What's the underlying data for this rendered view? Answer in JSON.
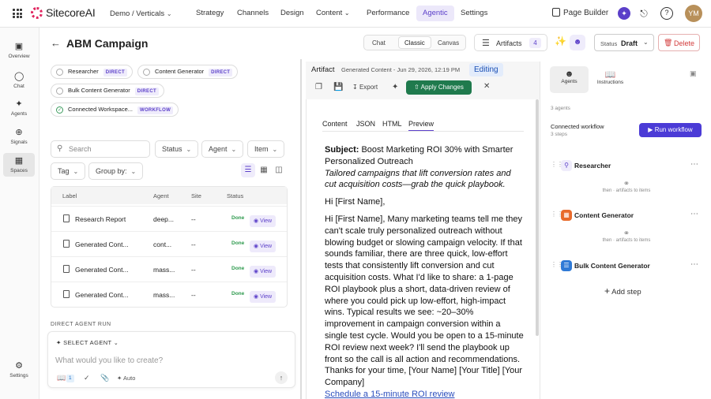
{
  "header": {
    "logo_text": "SitecoreAI",
    "org": "Demo / Verticals",
    "nav": [
      "Strategy",
      "Channels",
      "Design",
      "Content",
      "Performance",
      "Agentic",
      "Settings"
    ],
    "active_nav": "Agentic",
    "page_builder": "Page Builder",
    "avatar_initials": "YM"
  },
  "rail": {
    "items": [
      "Overview",
      "Chat",
      "Agents",
      "Signals",
      "Spaces"
    ],
    "bottom": "Settings"
  },
  "campaign": {
    "title": "ABM Campaign",
    "view_modes": [
      "Chat",
      "Classic",
      "Canvas"
    ],
    "active_mode": "Classic",
    "artifacts_label": "Artifacts",
    "artifacts_count": "4",
    "status_label": "Status",
    "status_value": "Draft",
    "delete_label": "Delete"
  },
  "chips": [
    {
      "label": "Researcher",
      "tag": "DIRECT"
    },
    {
      "label": "Content Generator",
      "tag": "DIRECT"
    },
    {
      "label": "Bulk Content Generator",
      "tag": "DIRECT"
    },
    {
      "label": "Connected Workspace...",
      "tag": "WORKFLOW"
    }
  ],
  "filters": {
    "search_placeholder": "Search",
    "status": "Status",
    "agent": "Agent",
    "item": "Item",
    "tag": "Tag",
    "group_by": "Group by:"
  },
  "table": {
    "columns": [
      "Label",
      "Agent",
      "Site",
      "Status"
    ],
    "rows": [
      {
        "label": "Research Report",
        "agent": "deep...",
        "site": "--",
        "status": "Done",
        "action": "View"
      },
      {
        "label": "Generated Cont...",
        "agent": "cont...",
        "site": "--",
        "status": "Done",
        "action": "View"
      },
      {
        "label": "Generated Cont...",
        "agent": "mass...",
        "site": "--",
        "status": "Done",
        "action": "View"
      },
      {
        "label": "Generated Cont...",
        "agent": "mass...",
        "site": "--",
        "status": "Done",
        "action": "View"
      }
    ]
  },
  "composer": {
    "section_label": "DIRECT AGENT RUN",
    "select_agent": "SELECT AGENT",
    "placeholder": "What would you like to create?",
    "badge": "1",
    "auto": "Auto"
  },
  "artifact": {
    "label": "Artifact",
    "meta": "Generated Content - Jun 29, 2026, 12:19 PM",
    "editing": "Editing",
    "export": "Export",
    "apply": "Apply Changes",
    "tabs": [
      "Content",
      "JSON",
      "HTML",
      "Preview"
    ],
    "active_tab": "Preview",
    "subject_label": "Subject:",
    "subject": "Boost Marketing ROI 30% with Smarter Personalized Outreach",
    "subtitle": "Tailored campaigns that lift conversion rates and cut acquisition costs—grab the quick playbook.",
    "greeting": "Hi [First Name],",
    "body": "Hi [First Name], Many marketing teams tell me they can't scale truly personalized outreach without blowing budget or slowing campaign velocity. If that sounds familiar, there are three quick, low-effort tests that consistently lift conversion and cut acquisition costs. What I'd like to share: a 1-page ROI playbook plus a short, data-driven review of where you could pick up low-effort, high-impact wins. Typical results we see: ~20–30% improvement in campaign conversion within a single test cycle. Would you be open to a 15-minute ROI review next week? I'll send the playbook up front so the call is all action and recommendations. Thanks for your time, [Your Name] [Your Title] [Your Company]",
    "cta": "Schedule a 15-minute ROI review"
  },
  "right_panel": {
    "tabs": [
      "Agents",
      "Instructions"
    ],
    "agents_count": "3 agents",
    "workflow_label": "Connected workflow",
    "workflow_steps": "3 steps",
    "run_workflow": "Run workflow",
    "steps": [
      "Researcher",
      "Content Generator",
      "Bulk Content Generator"
    ],
    "link_text": "then  ·  artifacts to items",
    "add_step": "Add step"
  },
  "colors": {
    "accent": "#5b3fc9",
    "success": "#2e9a4e",
    "apply": "#1f7a4d",
    "delete": "#d23b3b",
    "run": "#4b3bd6"
  }
}
